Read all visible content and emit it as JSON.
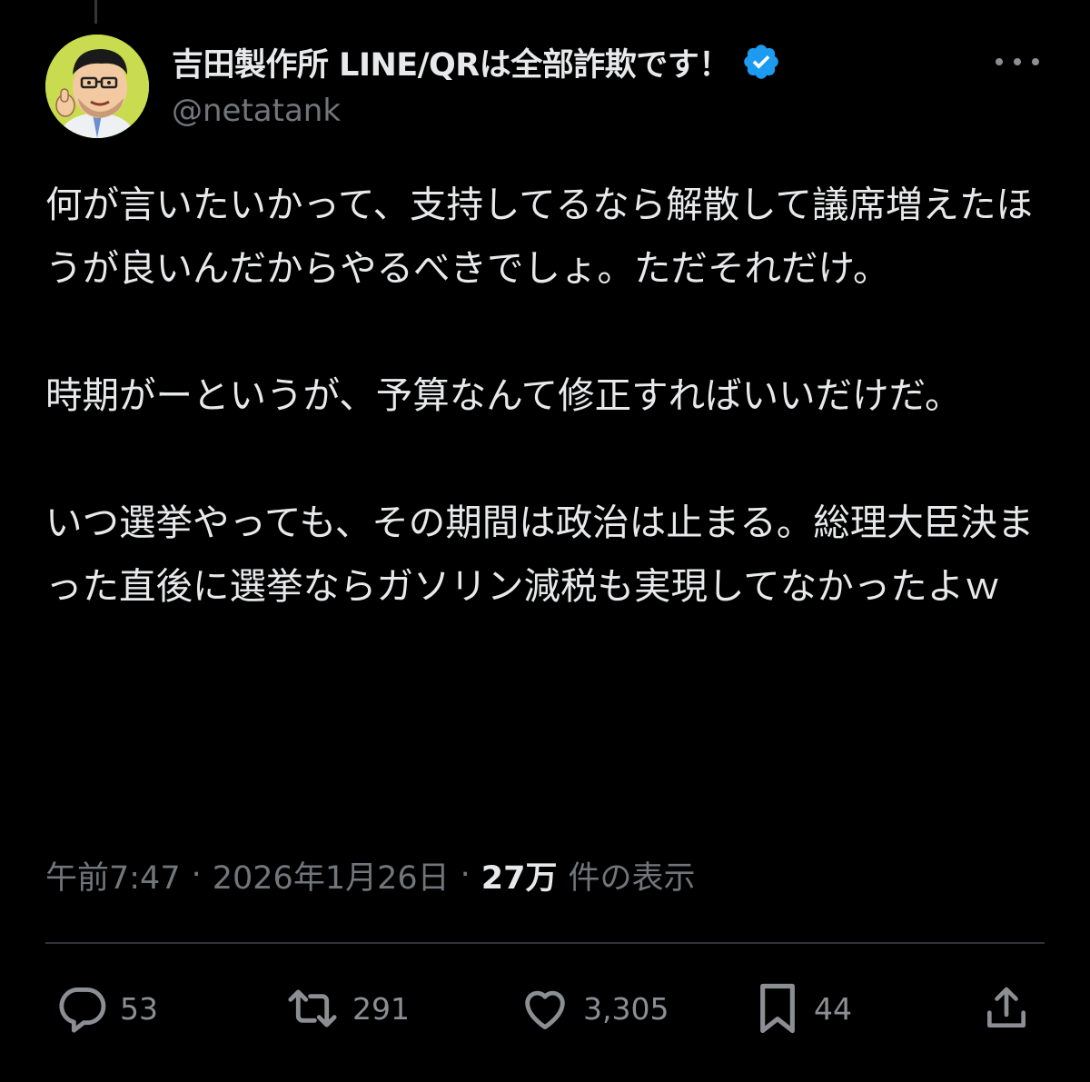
{
  "colors": {
    "background": "#000000",
    "text_primary": "#e7e9ea",
    "text_secondary": "#71767b",
    "verified_badge": "#1d9bf0",
    "divider": "#2f3336"
  },
  "author": {
    "display_name": "吉田製作所 LINE/QRは全部詐欺です！",
    "handle": "@netatank",
    "verified": true,
    "avatar_icon": "cartoon-man-thumbs-up-avatar",
    "verified_icon": "verified-badge-icon"
  },
  "more_icon": "more-dots-icon",
  "tweet": {
    "paragraphs": [
      "何が言いたいかって、支持してるなら解散して議席増えたほうが良いんだからやるべきでしょ。ただそれだけ。",
      "時期がーというが、予算なんて修正すればいいだけだ。",
      "いつ選挙やっても、その期間は政治は止まる。総理大臣決まった直後に選挙ならガソリン減税も実現してなかったよｗ"
    ]
  },
  "meta": {
    "time": "午前7:47",
    "separator": "·",
    "date": "2026年1月26日",
    "views_count": "27万",
    "views_label": "件の表示"
  },
  "actions": {
    "replies": {
      "icon": "reply-icon",
      "count": "53"
    },
    "retweets": {
      "icon": "retweet-icon",
      "count": "291"
    },
    "likes": {
      "icon": "heart-icon",
      "count": "3,305"
    },
    "bookmarks": {
      "icon": "bookmark-icon",
      "count": "44"
    },
    "share": {
      "icon": "share-icon"
    }
  }
}
